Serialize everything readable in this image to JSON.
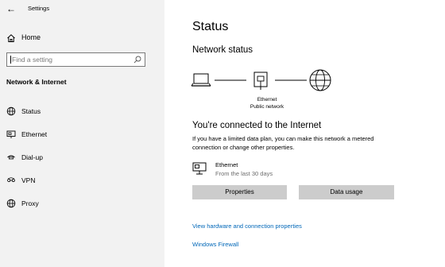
{
  "window": {
    "title": "Settings",
    "back": "←"
  },
  "sidebar": {
    "home_label": "Home",
    "search_placeholder": "Find a setting",
    "section_title": "Network & Internet",
    "items": [
      {
        "label": "Status",
        "icon": "globe-icon"
      },
      {
        "label": "Ethernet",
        "icon": "ethernet-icon"
      },
      {
        "label": "Dial-up",
        "icon": "dial-up-icon"
      },
      {
        "label": "VPN",
        "icon": "vpn-icon"
      },
      {
        "label": "Proxy",
        "icon": "proxy-icon"
      }
    ]
  },
  "main": {
    "title": "Status",
    "network_status": "Network status",
    "diagram": {
      "adapter_name": "Ethernet",
      "network_profile": "Public network"
    },
    "connected_heading": "You're connected to the Internet",
    "description": "If you have a limited data plan, you can make this network a metered connection or change other properties.",
    "connection": {
      "name": "Ethernet",
      "usage_period": "From the last 30 days"
    },
    "buttons": {
      "properties": "Properties",
      "data_usage": "Data usage"
    },
    "links": {
      "hardware": "View hardware and connection properties",
      "firewall": "Windows Firewall"
    }
  },
  "colors": {
    "sidebar_bg": "#f2f2f2",
    "link": "#0067b8",
    "button_bg": "#cccccc"
  }
}
